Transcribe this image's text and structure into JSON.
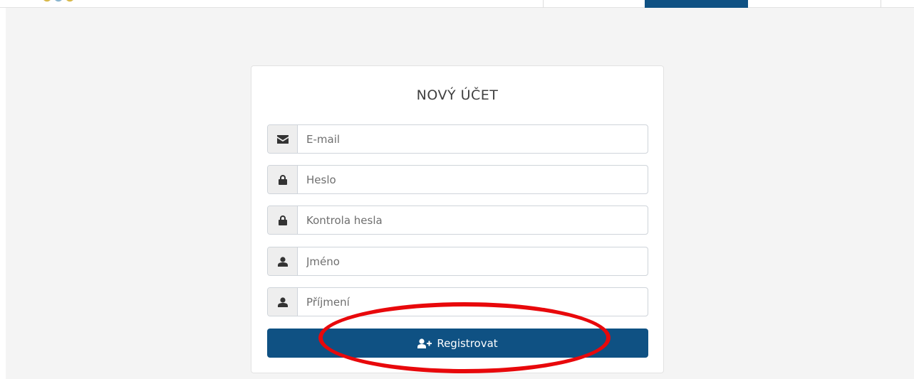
{
  "form": {
    "title": "NOVÝ ÚČET",
    "fields": [
      {
        "icon": "envelope-icon",
        "placeholder": "E-mail"
      },
      {
        "icon": "lock-icon",
        "placeholder": "Heslo"
      },
      {
        "icon": "lock-icon",
        "placeholder": "Kontrola hesla"
      },
      {
        "icon": "user-icon",
        "placeholder": "Jméno"
      },
      {
        "icon": "user-icon",
        "placeholder": "Příjmení"
      }
    ],
    "submit_label": "Registrovat",
    "submit_icon": "user-plus-icon"
  },
  "colors": {
    "primary": "#0f5183",
    "annotation": "#e8080b",
    "background": "#f4f4f4"
  }
}
